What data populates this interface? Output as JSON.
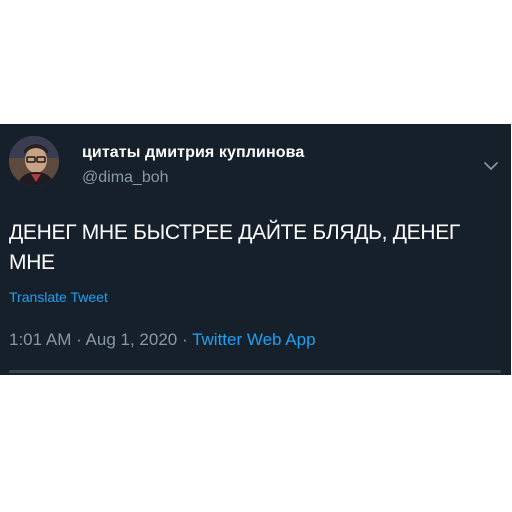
{
  "tweet": {
    "author_name": "цитаты дмитрия куплинова",
    "author_handle": "@dima_boh",
    "text": "ДЕНЕГ МНЕ БЫСТРЕЕ ДАЙТЕ БЛЯДЬ, ДЕНЕГ МНЕ",
    "translate_label": "Translate Tweet",
    "time": "1:01 AM",
    "separator": " · ",
    "date": "Aug 1, 2020",
    "source": "Twitter Web App",
    "menu_icon": "chevron-down-icon"
  },
  "colors": {
    "background": "#15202b",
    "text_primary": "#ffffff",
    "text_secondary": "#8899a6",
    "accent": "#1da1f2",
    "divider": "#38444d"
  }
}
